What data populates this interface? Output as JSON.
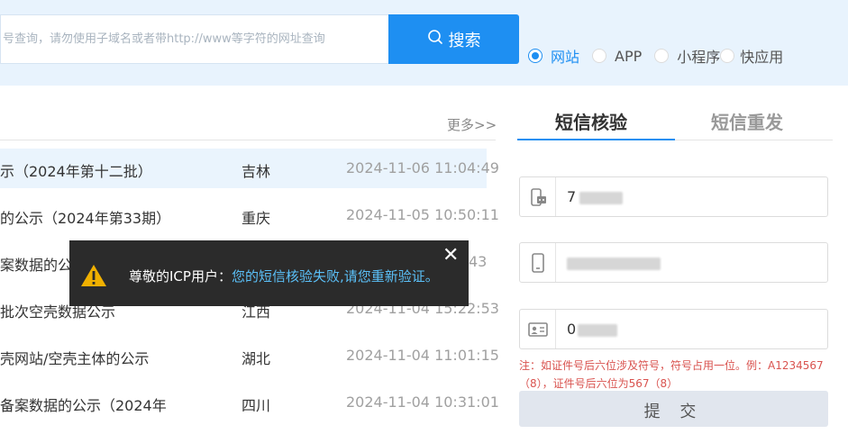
{
  "search": {
    "placeholder_visible": "号查询，请勿使用子域名或者带http://www等字符的网址查询",
    "button_label": "搜索"
  },
  "radio_options": [
    {
      "label": "网站",
      "checked": true
    },
    {
      "label": "APP",
      "checked": false
    },
    {
      "label": "小程序",
      "checked": false
    },
    {
      "label": "快应用",
      "checked": false
    }
  ],
  "list": {
    "more_label": "更多>>",
    "rows": [
      {
        "title": "示（2024年第十二批）",
        "province": "吉林",
        "date": "2024-11-06 11:04:49"
      },
      {
        "title": "的公示（2024年第33期）",
        "province": "重庆",
        "date": "2024-11-05 10:50:11"
      },
      {
        "title": "案数据的公示",
        "province": "",
        "date": "43"
      },
      {
        "title": "批次空壳数据公示",
        "province": "江西",
        "date": "2024-11-04 15:22:53"
      },
      {
        "title": "壳网站/空壳主体的公示",
        "province": "湖北",
        "date": "2024-11-04 11:01:15"
      },
      {
        "title": "备案数据的公示（2024年",
        "province": "四川",
        "date": "2024-11-04 10:31:01"
      }
    ]
  },
  "sms_panel": {
    "tabs": [
      "短信核验",
      "短信重发"
    ],
    "fields": [
      {
        "icon": "phone-card-icon",
        "value": "7"
      },
      {
        "icon": "mobile-phone-icon",
        "value": ""
      },
      {
        "icon": "id-card-icon",
        "value": "0"
      }
    ],
    "note": "注：如证件号后六位涉及符号，符号占用一位。例：A1234567（8），证件号后六位为567（8）",
    "submit_label": "提 交"
  },
  "toast": {
    "prefix": "尊敬的ICP用户：",
    "message": "您的短信核验失败,请您重新验证。",
    "close_label": "✕"
  },
  "colors": {
    "accent": "#1e8ff2",
    "top_band": "#e8f3fd",
    "warning": "#f0b000",
    "note_red": "#d9534f",
    "toast_bg": "#2b2b2b"
  }
}
